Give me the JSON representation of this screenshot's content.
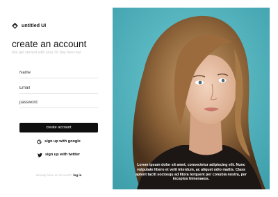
{
  "brand": {
    "name": "untitled UI",
    "icon": "layers-logo-icon"
  },
  "form": {
    "title": "create an account",
    "subtitle": "lets get started with your 30 day free trial",
    "name_placeholder": "Name",
    "email_placeholder": "Email",
    "password_placeholder": "password",
    "submit_label": "create account",
    "google_label": "sign up with google",
    "twitter_label": "sign up with  twitter",
    "footer_text": "already have an account?",
    "login_label": "log in"
  },
  "hero": {
    "caption": "Lorem ipsum dolor sit amet, consectetur adipiscing elit. Nunc vulputate libero et velit interdum, ac aliquet odio mattis. Class aptent taciti sociosqu ad litora torquent per conubia nostra, per inceptos himenaeos."
  },
  "colors": {
    "accent": "#0e0e0e",
    "hero_background": "#54b7c1",
    "muted_text": "#c5c5c5"
  }
}
